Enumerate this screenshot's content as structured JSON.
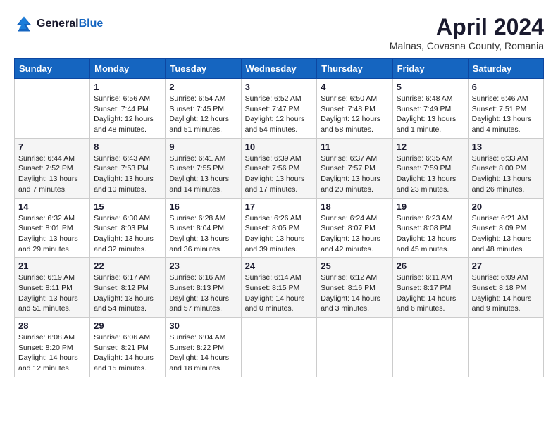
{
  "header": {
    "logo": {
      "general": "General",
      "blue": "Blue"
    },
    "month_title": "April 2024",
    "location": "Malnas, Covasna County, Romania"
  },
  "days": [
    "Sunday",
    "Monday",
    "Tuesday",
    "Wednesday",
    "Thursday",
    "Friday",
    "Saturday"
  ],
  "weeks": [
    [
      {
        "date": "",
        "text": ""
      },
      {
        "date": "1",
        "text": "Sunrise: 6:56 AM\nSunset: 7:44 PM\nDaylight: 12 hours and 48 minutes."
      },
      {
        "date": "2",
        "text": "Sunrise: 6:54 AM\nSunset: 7:45 PM\nDaylight: 12 hours and 51 minutes."
      },
      {
        "date": "3",
        "text": "Sunrise: 6:52 AM\nSunset: 7:47 PM\nDaylight: 12 hours and 54 minutes."
      },
      {
        "date": "4",
        "text": "Sunrise: 6:50 AM\nSunset: 7:48 PM\nDaylight: 12 hours and 58 minutes."
      },
      {
        "date": "5",
        "text": "Sunrise: 6:48 AM\nSunset: 7:49 PM\nDaylight: 13 hours and 1 minute."
      },
      {
        "date": "6",
        "text": "Sunrise: 6:46 AM\nSunset: 7:51 PM\nDaylight: 13 hours and 4 minutes."
      }
    ],
    [
      {
        "date": "7",
        "text": "Sunrise: 6:44 AM\nSunset: 7:52 PM\nDaylight: 13 hours and 7 minutes."
      },
      {
        "date": "8",
        "text": "Sunrise: 6:43 AM\nSunset: 7:53 PM\nDaylight: 13 hours and 10 minutes."
      },
      {
        "date": "9",
        "text": "Sunrise: 6:41 AM\nSunset: 7:55 PM\nDaylight: 13 hours and 14 minutes."
      },
      {
        "date": "10",
        "text": "Sunrise: 6:39 AM\nSunset: 7:56 PM\nDaylight: 13 hours and 17 minutes."
      },
      {
        "date": "11",
        "text": "Sunrise: 6:37 AM\nSunset: 7:57 PM\nDaylight: 13 hours and 20 minutes."
      },
      {
        "date": "12",
        "text": "Sunrise: 6:35 AM\nSunset: 7:59 PM\nDaylight: 13 hours and 23 minutes."
      },
      {
        "date": "13",
        "text": "Sunrise: 6:33 AM\nSunset: 8:00 PM\nDaylight: 13 hours and 26 minutes."
      }
    ],
    [
      {
        "date": "14",
        "text": "Sunrise: 6:32 AM\nSunset: 8:01 PM\nDaylight: 13 hours and 29 minutes."
      },
      {
        "date": "15",
        "text": "Sunrise: 6:30 AM\nSunset: 8:03 PM\nDaylight: 13 hours and 32 minutes."
      },
      {
        "date": "16",
        "text": "Sunrise: 6:28 AM\nSunset: 8:04 PM\nDaylight: 13 hours and 36 minutes."
      },
      {
        "date": "17",
        "text": "Sunrise: 6:26 AM\nSunset: 8:05 PM\nDaylight: 13 hours and 39 minutes."
      },
      {
        "date": "18",
        "text": "Sunrise: 6:24 AM\nSunset: 8:07 PM\nDaylight: 13 hours and 42 minutes."
      },
      {
        "date": "19",
        "text": "Sunrise: 6:23 AM\nSunset: 8:08 PM\nDaylight: 13 hours and 45 minutes."
      },
      {
        "date": "20",
        "text": "Sunrise: 6:21 AM\nSunset: 8:09 PM\nDaylight: 13 hours and 48 minutes."
      }
    ],
    [
      {
        "date": "21",
        "text": "Sunrise: 6:19 AM\nSunset: 8:11 PM\nDaylight: 13 hours and 51 minutes."
      },
      {
        "date": "22",
        "text": "Sunrise: 6:17 AM\nSunset: 8:12 PM\nDaylight: 13 hours and 54 minutes."
      },
      {
        "date": "23",
        "text": "Sunrise: 6:16 AM\nSunset: 8:13 PM\nDaylight: 13 hours and 57 minutes."
      },
      {
        "date": "24",
        "text": "Sunrise: 6:14 AM\nSunset: 8:15 PM\nDaylight: 14 hours and 0 minutes."
      },
      {
        "date": "25",
        "text": "Sunrise: 6:12 AM\nSunset: 8:16 PM\nDaylight: 14 hours and 3 minutes."
      },
      {
        "date": "26",
        "text": "Sunrise: 6:11 AM\nSunset: 8:17 PM\nDaylight: 14 hours and 6 minutes."
      },
      {
        "date": "27",
        "text": "Sunrise: 6:09 AM\nSunset: 8:18 PM\nDaylight: 14 hours and 9 minutes."
      }
    ],
    [
      {
        "date": "28",
        "text": "Sunrise: 6:08 AM\nSunset: 8:20 PM\nDaylight: 14 hours and 12 minutes."
      },
      {
        "date": "29",
        "text": "Sunrise: 6:06 AM\nSunset: 8:21 PM\nDaylight: 14 hours and 15 minutes."
      },
      {
        "date": "30",
        "text": "Sunrise: 6:04 AM\nSunset: 8:22 PM\nDaylight: 14 hours and 18 minutes."
      },
      {
        "date": "",
        "text": ""
      },
      {
        "date": "",
        "text": ""
      },
      {
        "date": "",
        "text": ""
      },
      {
        "date": "",
        "text": ""
      }
    ]
  ]
}
